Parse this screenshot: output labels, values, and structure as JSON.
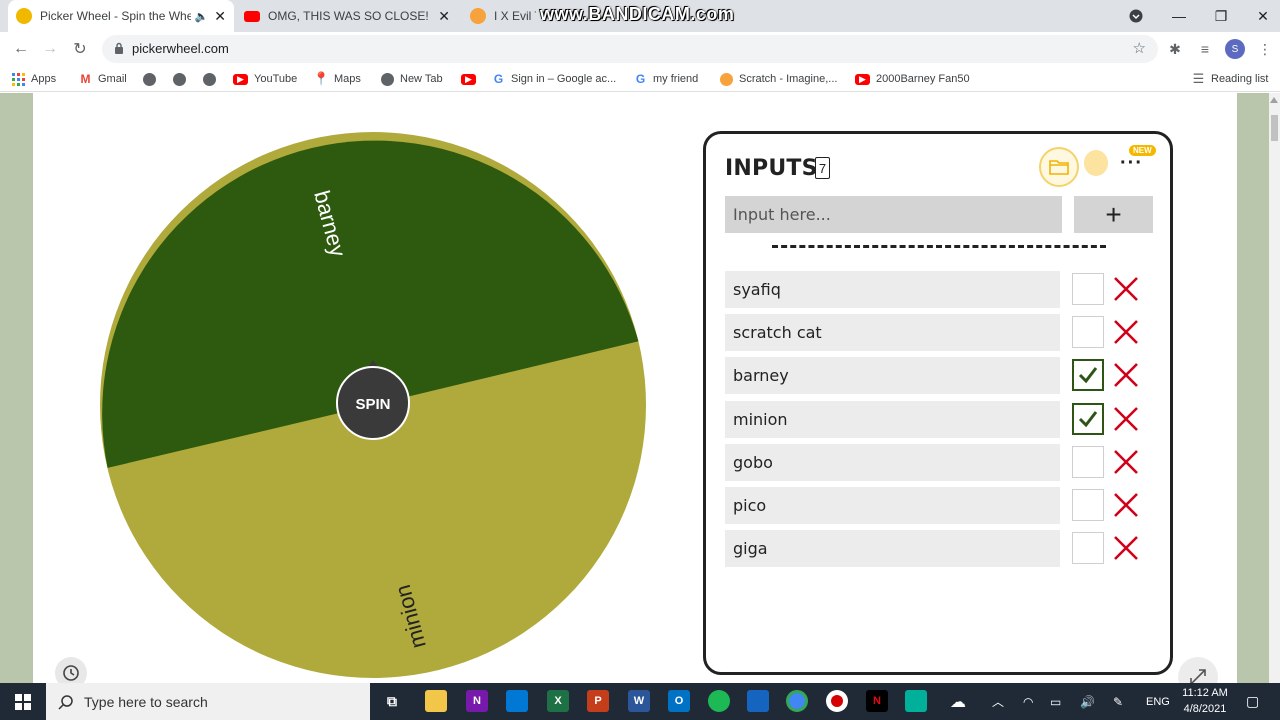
{
  "browser": {
    "tabs": [
      {
        "title": "Picker Wheel - Spin the Whe",
        "active": true,
        "favicon_color": "#f1b800"
      },
      {
        "title": "OMG, THIS WAS SO CLOSE! Duc",
        "active": false,
        "favicon_color": "#ff0000"
      },
      {
        "title": "I X Evil Ta",
        "active": false,
        "favicon_color": "#f7a23b"
      }
    ],
    "watermark": "www.BANDICAM.com",
    "url": "pickerwheel.com",
    "profile_initial": "S",
    "bookmarks": [
      {
        "label": "Apps",
        "icon": "apps-grid-icon"
      },
      {
        "label": "Gmail",
        "icon": "gmail-icon"
      },
      {
        "label": "",
        "icon": "globe-icon"
      },
      {
        "label": "",
        "icon": "globe-icon"
      },
      {
        "label": "",
        "icon": "globe-icon"
      },
      {
        "label": "YouTube",
        "icon": "youtube-icon"
      },
      {
        "label": "Maps",
        "icon": "maps-icon"
      },
      {
        "label": "New Tab",
        "icon": "globe-icon"
      },
      {
        "label": "",
        "icon": "youtube-icon"
      },
      {
        "label": "Sign in – Google ac...",
        "icon": "google-icon"
      },
      {
        "label": "my friend",
        "icon": "google-icon"
      },
      {
        "label": "Scratch - Imagine,...",
        "icon": "scratch-icon"
      },
      {
        "label": "2000Barney Fan50",
        "icon": "youtube-icon"
      }
    ],
    "reading_list": "Reading list"
  },
  "wheel": {
    "spin_label": "SPIN",
    "segments": [
      {
        "label": "barney",
        "color": "#2d5a0f"
      },
      {
        "label": "minion",
        "color": "#b0aa3c"
      }
    ]
  },
  "panel": {
    "title": "INPUTS",
    "count": "7",
    "new_badge": "NEW",
    "more": "···",
    "input_placeholder": "Input here...",
    "add_label": "+",
    "entries": [
      {
        "label": "syafiq",
        "checked": false
      },
      {
        "label": "scratch cat",
        "checked": false
      },
      {
        "label": "barney",
        "checked": true
      },
      {
        "label": "minion",
        "checked": true
      },
      {
        "label": "gobo",
        "checked": false
      },
      {
        "label": "pico",
        "checked": false
      },
      {
        "label": "giga",
        "checked": false
      }
    ]
  },
  "taskbar": {
    "search_placeholder": "Type here to search",
    "language": "ENG",
    "time": "11:12 AM",
    "date": "4/8/2021"
  },
  "colors": {
    "page_side": "#b9c6ac",
    "dark_green": "#2d5a0f",
    "olive": "#b0aa3c",
    "delete_red": "#d0021b",
    "check_green": "#2e5416"
  }
}
